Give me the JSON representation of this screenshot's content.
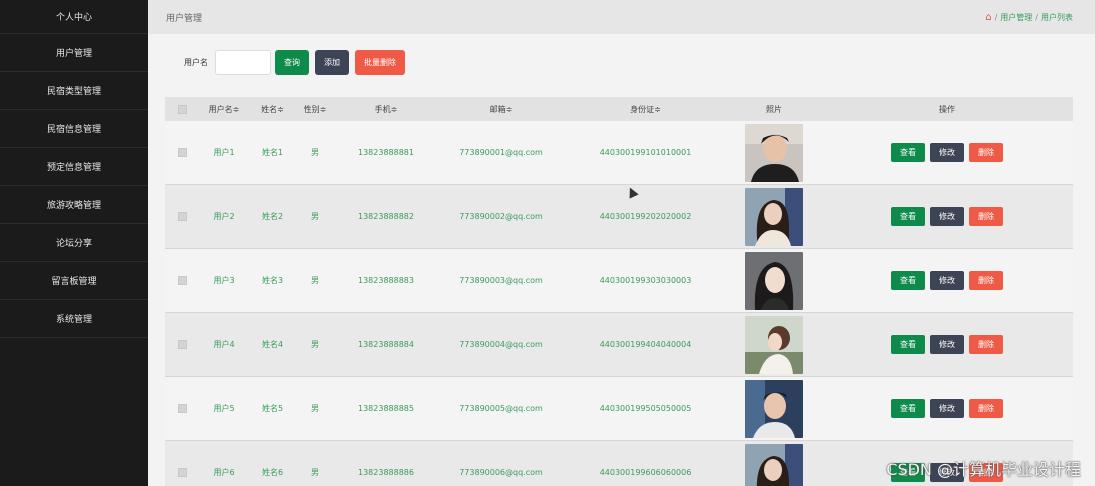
{
  "sidebar": {
    "items": [
      "个人中心",
      "用户管理",
      "民宿类型管理",
      "民宿信息管理",
      "预定信息管理",
      "旅游攻略管理",
      "论坛分享",
      "留言板管理",
      "系统管理"
    ]
  },
  "topbar": {
    "title": "用户管理",
    "breadcrumb": [
      "用户管理",
      "用户列表"
    ],
    "separator": "/"
  },
  "search": {
    "label": "用户名",
    "input_value": "",
    "query_label": "查询",
    "add_label": "添加",
    "batch_delete_label": "批量删除"
  },
  "table": {
    "headers": {
      "username": "用户名≑",
      "name": "姓名≑",
      "sex": "性别≑",
      "phone": "手机≑",
      "email": "邮箱≑",
      "idcard": "身份证≑",
      "photo": "照片",
      "ops": "操作"
    },
    "actions": {
      "view": "查看",
      "edit": "修改",
      "delete": "删除"
    },
    "rows": [
      {
        "username": "用户1",
        "name": "姓名1",
        "sex": "男",
        "phone": "13823888881",
        "email": "773890001@qq.com",
        "idcard": "440300199101010001"
      },
      {
        "username": "用户2",
        "name": "姓名2",
        "sex": "男",
        "phone": "13823888882",
        "email": "773890002@qq.com",
        "idcard": "440300199202020002"
      },
      {
        "username": "用户3",
        "name": "姓名3",
        "sex": "男",
        "phone": "13823888883",
        "email": "773890003@qq.com",
        "idcard": "440300199303030003"
      },
      {
        "username": "用户4",
        "name": "姓名4",
        "sex": "男",
        "phone": "13823888884",
        "email": "773890004@qq.com",
        "idcard": "440300199404040004"
      },
      {
        "username": "用户5",
        "name": "姓名5",
        "sex": "男",
        "phone": "13823888885",
        "email": "773890005@qq.com",
        "idcard": "440300199505050005"
      },
      {
        "username": "用户6",
        "name": "姓名6",
        "sex": "男",
        "phone": "13823888886",
        "email": "773890006@qq.com",
        "idcard": "440300199606060006"
      }
    ]
  },
  "watermark": "CSDN @计算机毕业设计程",
  "colors": {
    "accent_green": "#0e8a4a",
    "dark": "#3d4456",
    "danger": "#ef5a47",
    "text_green": "#3b9b5c"
  }
}
